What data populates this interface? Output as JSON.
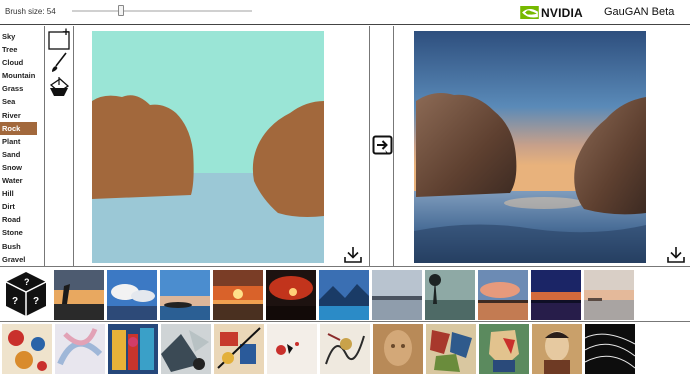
{
  "header": {
    "brush_size_label": "Brush size: 54",
    "brush_size_value": 54,
    "brand": "NVIDIA",
    "app_title": "GauGAN Beta"
  },
  "labels": {
    "items": [
      "Sky",
      "Tree",
      "Cloud",
      "Mountain",
      "Grass",
      "Sea",
      "River",
      "Rock",
      "Plant",
      "Sand",
      "Snow",
      "Water",
      "Hill",
      "Dirt",
      "Road",
      "Stone",
      "Bush",
      "Gravel"
    ],
    "selected": "Rock"
  },
  "tools": [
    "new-canvas-icon",
    "brush-icon",
    "paint-bucket-icon"
  ],
  "buttons": {
    "render": "right-arrow-icon",
    "download": "download-icon"
  },
  "colors": {
    "sky": "#9ae5d6",
    "sea": "#9bc8d6",
    "rock": "#a2683c",
    "selected_label_bg": "#a2683c"
  },
  "thumbnails": {
    "style_row": [
      "random-style-dice-icon",
      "sunset-tree",
      "blue-sky-clouds",
      "coast-dusk",
      "orange-sunset",
      "red-sky",
      "blue-mountain-lake",
      "grey-lake",
      "tree-silhouette-lake",
      "pink-clouds-sunset",
      "purple-sunset",
      "pale-beach"
    ],
    "art_row": [
      "folk-art",
      "pastel-sketch",
      "colorful-street",
      "abstract-paint",
      "kandinsky-style",
      "paint-splash",
      "ink-drawing",
      "sepia-portrait",
      "cubist-figures",
      "cubist-portrait",
      "picasso-style",
      "black-waves"
    ]
  }
}
